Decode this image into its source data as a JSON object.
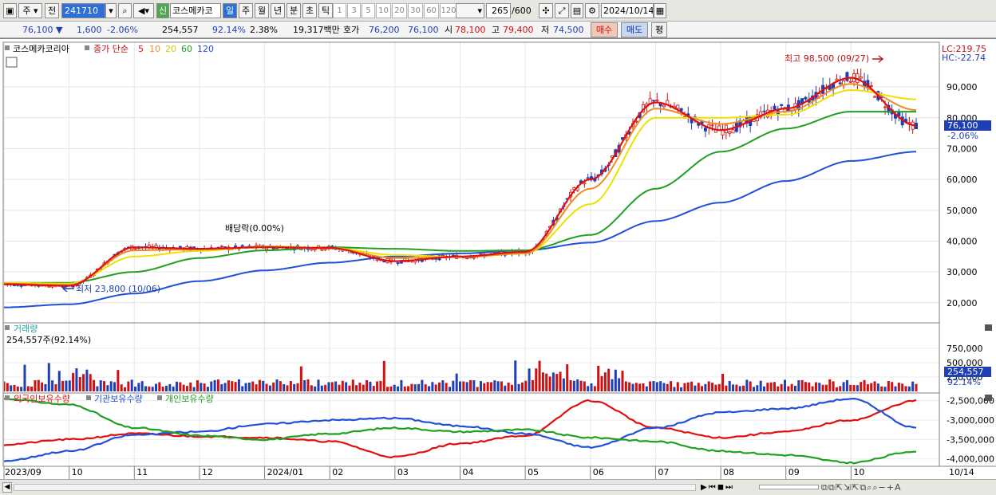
{
  "toolbar": {
    "period_letter": "주",
    "prev_label": "전",
    "code": "241710",
    "new_badge": "신",
    "stock_name": "코스메카코",
    "tabs": [
      "일",
      "주",
      "월",
      "년",
      "분",
      "초",
      "틱"
    ],
    "active_tab": "일",
    "intervals": [
      "1",
      "3",
      "5",
      "10",
      "20",
      "30",
      "60",
      "120"
    ],
    "count_label": "265",
    "count_total": "/600",
    "date": "2024/10/14"
  },
  "infobar": {
    "price": "76,100",
    "change": "1,600",
    "change_pct": "-2.06%",
    "volume": "254,557",
    "volume_ratio": "92.14%",
    "turnover": "2.38%",
    "amount": "19,317백만",
    "bid_label": "호가",
    "ask_value": "76,200",
    "bid_value": "76,100",
    "open_label": "시",
    "open_value": "78,100",
    "high_label": "고",
    "high_value": "79,400",
    "low_label": "저",
    "low_value": "74,500",
    "buy_label": "매수",
    "sell_label": "매도",
    "eval_label": "평"
  },
  "price_legend": {
    "name": "코스메카코리아",
    "ind_label": "종가 단순",
    "periods": [
      "5",
      "10",
      "20",
      "60",
      "120"
    ],
    "lc": "LC:219.75",
    "hc": "HC:-22.74"
  },
  "volume_legend": {
    "title": "거래량",
    "value": "254,557주(92.14%)",
    "current": "254,557",
    "pct": "92.14%"
  },
  "holding_legend": {
    "foreign": "외국인보유수량",
    "inst": "기관보유수량",
    "indiv": "개인보유수량"
  },
  "annotations": {
    "high": "최고 98,500 (09/27)",
    "low": "최저 23,800 (10/06)",
    "dividend": "배당락(0.00%)",
    "price_tag": "76,100",
    "pct_tag": "-2.06%"
  },
  "xaxis_labels": [
    "2023/09",
    "10",
    "11",
    "12",
    "2024/01",
    "02",
    "03",
    "04",
    "05",
    "06",
    "07",
    "08",
    "09",
    "10",
    "10/14"
  ],
  "colors": {
    "up": "#d01010",
    "down": "#1f3fb4",
    "ma5": "#e01010",
    "ma10": "#f08c20",
    "ma20": "#f0e000",
    "ma60": "#20a020",
    "ma120": "#2050d8",
    "foreign": "#e01010",
    "inst": "#2050d8",
    "indiv": "#20a020"
  },
  "chart_data": [
    {
      "type": "line",
      "title": "코스메카코리아",
      "note": "Daily price (candlestick) with moving averages",
      "x": [
        "2023/09",
        "2023/10",
        "2023/11",
        "2023/12",
        "2024/01",
        "2024/02",
        "2024/03",
        "2024/04",
        "2024/05",
        "2024/06",
        "2024/07",
        "2024/08",
        "2024/09",
        "2024/10",
        "2024/10/14"
      ],
      "series": [
        {
          "name": "5",
          "values": [
            26000,
            25500,
            38000,
            37500,
            38000,
            37800,
            33500,
            35000,
            36500,
            60000,
            85000,
            76000,
            83000,
            93000,
            77500
          ]
        },
        {
          "name": "10",
          "values": [
            26200,
            25800,
            37000,
            37300,
            38200,
            37600,
            34500,
            34800,
            36000,
            57000,
            83000,
            78000,
            82000,
            91000,
            82500
          ]
        },
        {
          "name": "20",
          "values": [
            26500,
            26200,
            35000,
            36800,
            38300,
            37800,
            35500,
            34800,
            36000,
            52000,
            80000,
            80000,
            81000,
            89000,
            86000
          ]
        },
        {
          "name": "60",
          "values": [
            26500,
            26500,
            30000,
            34500,
            37000,
            38000,
            37500,
            36800,
            37000,
            42000,
            57000,
            69000,
            76500,
            82000,
            82000
          ]
        },
        {
          "name": "120",
          "values": [
            18500,
            19500,
            23000,
            27000,
            30500,
            33000,
            35000,
            36000,
            37000,
            39500,
            46500,
            52500,
            59500,
            66000,
            69000
          ]
        }
      ],
      "ylim": [
        14000,
        104000
      ],
      "yticks": [
        "90,000",
        "80,000",
        "70,000",
        "60,000",
        "50,000",
        "40,000",
        "30,000",
        "20,000"
      ],
      "high": 98500,
      "low": 23800,
      "last": 76100
    },
    {
      "type": "bar",
      "title": "거래량",
      "yticks": [
        "750,000",
        "500,000",
        "250,000"
      ],
      "ylim": [
        0,
        1000000
      ],
      "last": 254557
    },
    {
      "type": "line",
      "series": [
        {
          "name": "외국인보유수량",
          "values": [
            -3630000,
            -3500000,
            -3350000,
            -3420000,
            -3450000,
            -3550000,
            -3950000,
            -3600000,
            -3400000,
            -2500000,
            -3200000,
            -3450000,
            -3300000,
            -3000000,
            -2500000
          ]
        },
        {
          "name": "기관보유수량",
          "values": [
            -4050000,
            -3800000,
            -3380000,
            -3300000,
            -3100000,
            -3000000,
            -2950000,
            -3150000,
            -3350000,
            -3700000,
            -3200000,
            -2800000,
            -2700000,
            -2450000,
            -3200000
          ]
        },
        {
          "name": "개인보유수량",
          "values": [
            -2450000,
            -2600000,
            -3200000,
            -3400000,
            -3500000,
            -3350000,
            -3200000,
            -3300000,
            -3250000,
            -3450000,
            -3550000,
            -3800000,
            -3900000,
            -4100000,
            -3800000
          ]
        }
      ],
      "ylim": [
        -4150000,
        -2300000
      ],
      "yticks": [
        "-2,500,000",
        "-3,000,000",
        "-3,500,000",
        "-4,000,000"
      ]
    }
  ]
}
